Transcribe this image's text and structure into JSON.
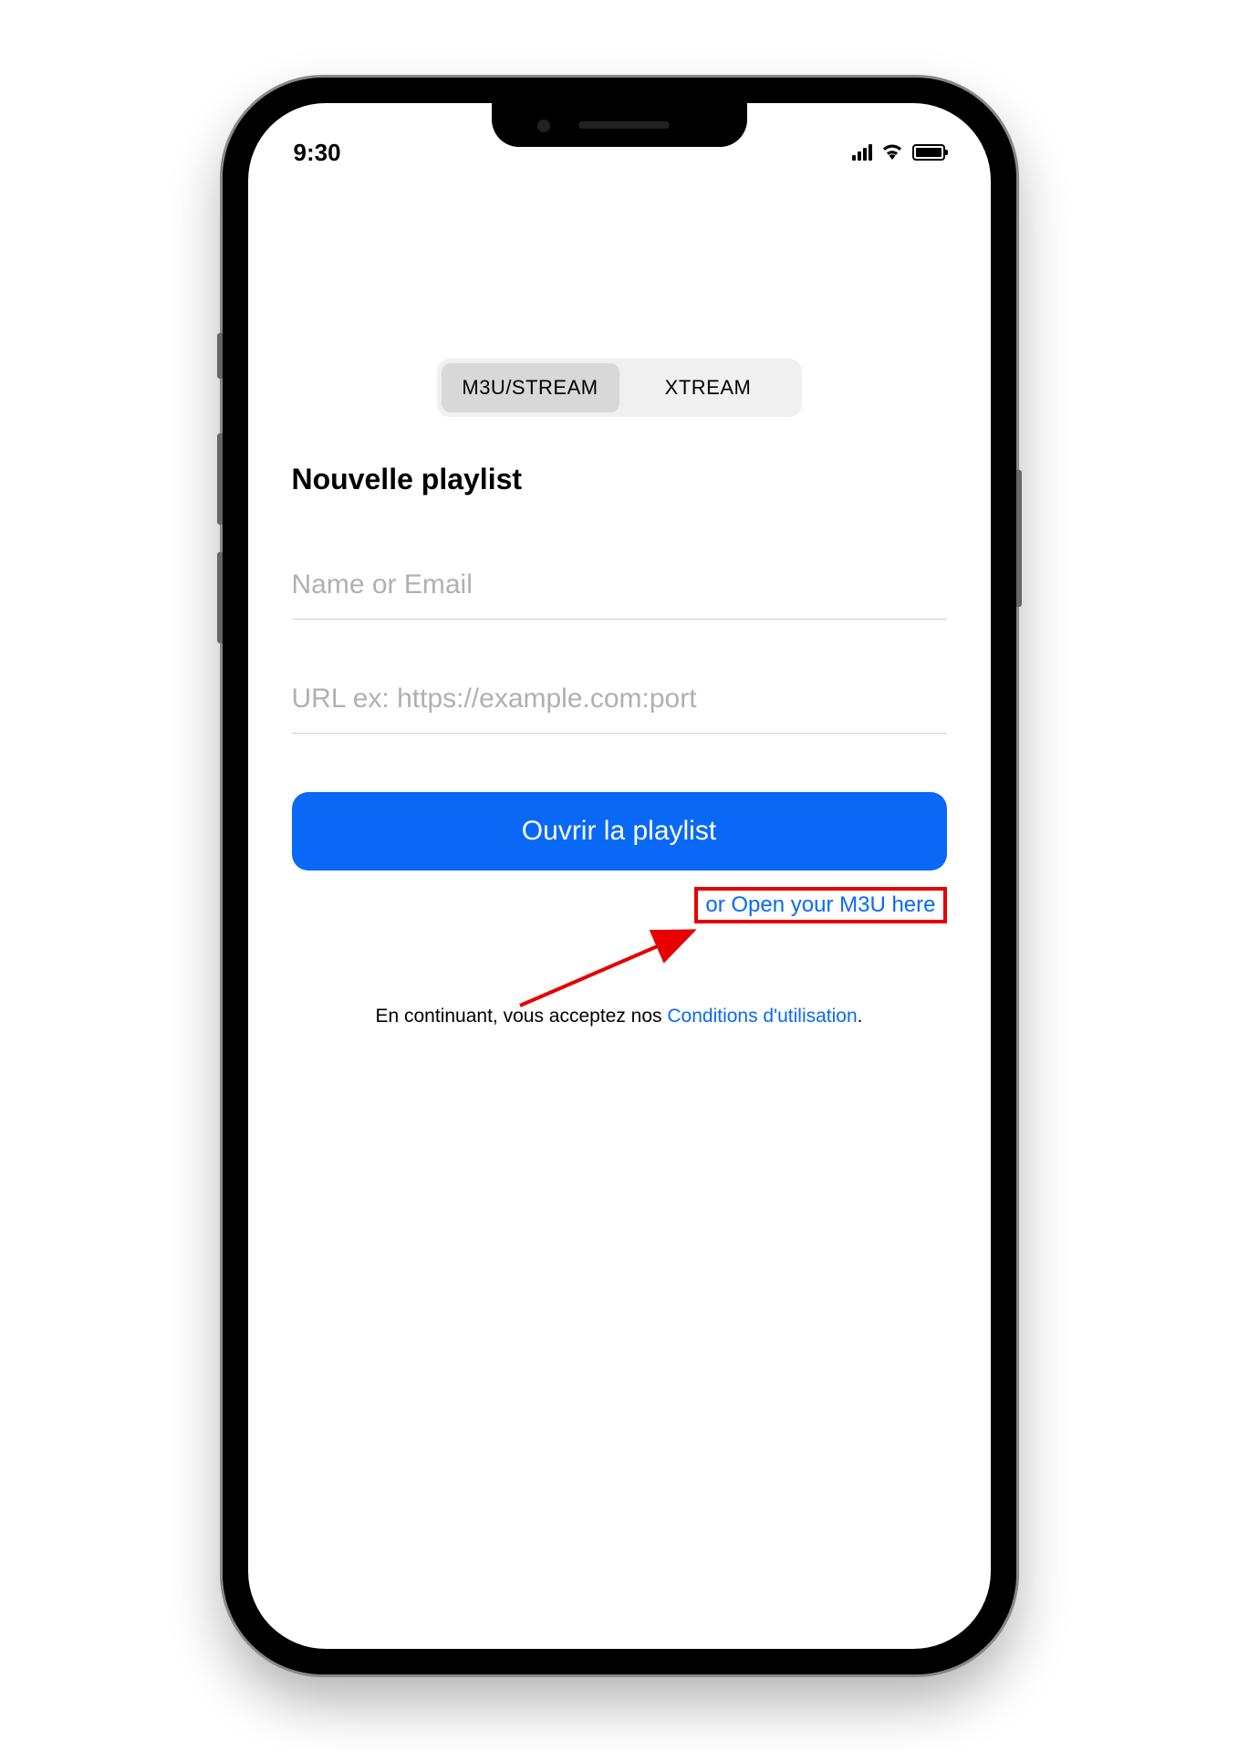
{
  "status_bar": {
    "time": "9:30"
  },
  "segmented": {
    "tab1": "M3U/STREAM",
    "tab2": "XTREAM"
  },
  "page": {
    "title": "Nouvelle playlist"
  },
  "inputs": {
    "name_placeholder": "Name or Email",
    "url_placeholder": "URL ex: https://example.com:port"
  },
  "buttons": {
    "open_playlist": "Ouvrir la playlist",
    "open_m3u_link": "or Open your M3U here"
  },
  "terms": {
    "prefix": "En continuant, vous acceptez nos ",
    "link": "Conditions d'utilisation",
    "suffix": "."
  }
}
